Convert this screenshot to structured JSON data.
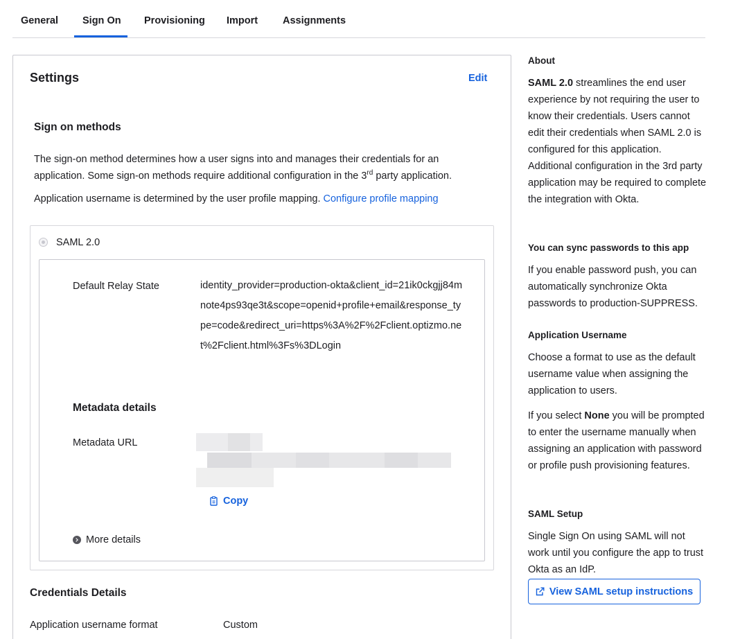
{
  "tabs": [
    {
      "label": "General"
    },
    {
      "label": "Sign On"
    },
    {
      "label": "Provisioning"
    },
    {
      "label": "Import"
    },
    {
      "label": "Assignments"
    }
  ],
  "settings": {
    "title": "Settings",
    "edit_label": "Edit",
    "sign_on_methods": {
      "title": "Sign on methods",
      "description_part1": "The sign-on method determines how a user signs into and manages their credentials for an application. Some sign-on methods require additional configuration in the 3",
      "description_sup": "rd",
      "description_part2": " party application.",
      "username_text": "Application username is determined by the user profile mapping.",
      "username_link": "Configure profile mapping"
    },
    "saml": {
      "label": "SAML 2.0",
      "relay_state_label": "Default Relay State",
      "relay_state_value": "identity_provider=production-okta&client_id=21ik0ckgjj84mnote4ps93qe3t&scope=openid+profile+email&response_type=code&redirect_uri=https%3A%2F%2Fclient.optizmo.net%2Fclient.html%3Fs%3DLogin",
      "metadata_title": "Metadata details",
      "metadata_url_label": "Metadata URL",
      "copy_label": "Copy",
      "more_details_label": "More details"
    },
    "credentials": {
      "title": "Credentials Details",
      "username_format_label": "Application username format",
      "username_format_value": "Custom"
    }
  },
  "sidebar": {
    "about_title": "About",
    "about_bold": "SAML 2.0",
    "about_text": " streamlines the end user experience by not requiring the user to know their credentials. Users cannot edit their credentials when SAML 2.0 is configured for this application. Additional configuration in the 3rd party application may be required to complete the integration with Okta.",
    "sync_title": "You can sync passwords to this app",
    "sync_text": "If you enable password push, you can automatically synchronize Okta passwords to production-SUPPRESS.",
    "username_title": "Application Username",
    "username_text": "Choose a format to use as the default username value when assigning the application to users.",
    "username_text2_part1": "If you select ",
    "username_text2_bold": "None",
    "username_text2_part2": " you will be prompted to enter the username manually when assigning an application with password or profile push provisioning features.",
    "setup_title": "SAML Setup",
    "setup_text": "Single Sign On using SAML will not work until you configure the app to trust Okta as an IdP.",
    "setup_button": "View SAML setup instructions"
  },
  "icons": {
    "copy": "clipboard-icon",
    "more_details": "chevron-right-circle-icon",
    "external": "external-link-icon"
  },
  "colors": {
    "accent": "#1662dd",
    "border": "#c8c8cf"
  }
}
